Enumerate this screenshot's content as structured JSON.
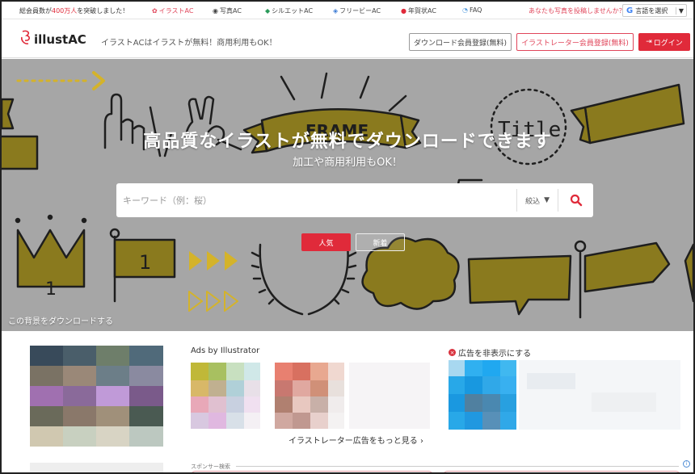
{
  "topbar": {
    "notice_pre": "総会員数が",
    "notice_hl": "400万人",
    "notice_post": "を突破しました！",
    "links": [
      {
        "icon": "illust-icon",
        "label": "イラストAC"
      },
      {
        "icon": "camera-icon",
        "label": "写真AC"
      },
      {
        "icon": "silhouette-icon",
        "label": "シルエットAC"
      },
      {
        "icon": "vector-icon",
        "label": "フリービーAC"
      },
      {
        "icon": "newyear-icon",
        "label": "年賀状AC"
      },
      {
        "icon": "faq-icon",
        "label": "FAQ"
      }
    ],
    "promo": "あなたも写真を投稿しませんか？",
    "language": "言語を選択",
    "language_g": "G",
    "language_caret": "▼"
  },
  "header": {
    "logo": "illustAC",
    "tagline": "イラストACはイラストが無料！商用利用もOK！",
    "btn_download_register": "ダウンロード会員登録(無料)",
    "btn_illustrator_register": "イラストレーター会員登録(無料)",
    "btn_login": "ログイン"
  },
  "hero": {
    "title": "高品質なイラストが無料でダウンロードできます",
    "subtitle": "加工や商用利用もOK！",
    "search_placeholder": "キーワード（例：桜）",
    "filter_label": "絞込",
    "tab_popular": "人気",
    "tab_new": "新着",
    "bg_download": "この背景をダウンロードする",
    "deco_frame": "FRAME",
    "deco_title": "Title",
    "deco_one_a": "1",
    "deco_one_b": "1"
  },
  "content": {
    "ads_label": "Ads by Illustrator",
    "hide_ad": "広告を非表示にする",
    "more_ads": "イラストレーター広告をもっと見る ›",
    "sponsor_search": "スポンサー検索",
    "info": "i"
  },
  "colors": {
    "accent": "#e02a3a",
    "hero_bg": "#a6a6a6",
    "mustard": "#8a7a1e"
  }
}
